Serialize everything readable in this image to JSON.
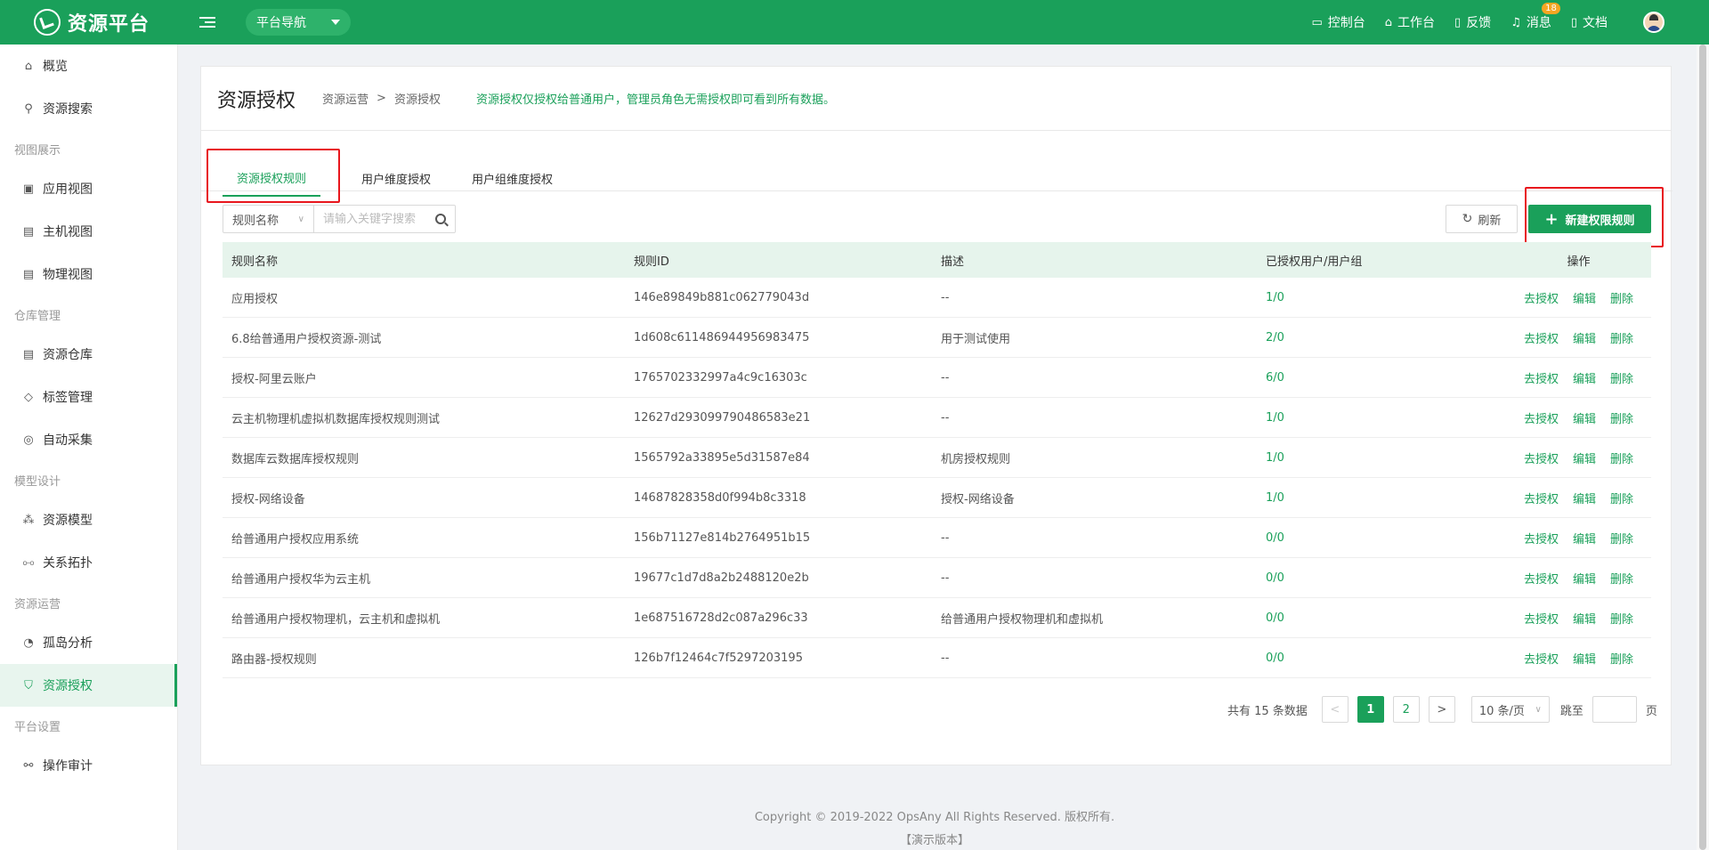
{
  "topbar": {
    "app_name": "资源平台",
    "nav_select": "平台导航",
    "items": [
      {
        "label": "控制台",
        "icon": "monitor-icon"
      },
      {
        "label": "工作台",
        "icon": "home-icon"
      },
      {
        "label": "反馈",
        "icon": "document-icon"
      },
      {
        "label": "消息",
        "icon": "bell-icon",
        "badge": "18"
      },
      {
        "label": "文档",
        "icon": "document-icon"
      }
    ]
  },
  "sidebar": {
    "overview": "概览",
    "search": "资源搜索",
    "group_view": "视图展示",
    "app_view": "应用视图",
    "host_view": "主机视图",
    "physical_view": "物理视图",
    "group_warehouse": "仓库管理",
    "resource_warehouse": "资源仓库",
    "tag_mgmt": "标签管理",
    "auto_collect": "自动采集",
    "group_model": "模型设计",
    "resource_model": "资源模型",
    "topology": "关系拓扑",
    "group_ops": "资源运营",
    "island": "孤岛分析",
    "auth": "资源授权",
    "group_platform": "平台设置",
    "audit": "操作审计"
  },
  "page": {
    "title": "资源授权",
    "breadcrumb": [
      "资源运营",
      ">",
      "资源授权"
    ],
    "notice": "资源授权仅授权给普通用户，管理员角色无需授权即可看到所有数据。"
  },
  "tabs": [
    "资源授权规则",
    "用户维度授权",
    "用户组维度授权"
  ],
  "filter": {
    "select": "规则名称",
    "placeholder": "请输入关键字搜索"
  },
  "buttons": {
    "refresh": "刷新",
    "new": "新建权限规则"
  },
  "table": {
    "headers": [
      "规则名称",
      "规则ID",
      "描述",
      "已授权用户/用户组",
      "操作"
    ],
    "actions": [
      "去授权",
      "编辑",
      "删除"
    ],
    "rows": [
      [
        "应用授权",
        "146e89849b881c062779043d",
        "--",
        "1/0"
      ],
      [
        "6.8给普通用户授权资源-测试",
        "1d608c611486944956983475",
        "用于测试使用",
        "2/0"
      ],
      [
        "授权-阿里云账户",
        "1765702332997a4c9c16303c",
        "--",
        "6/0"
      ],
      [
        "云主机物理机虚拟机数据库授权规则测试",
        "12627d293099790486583e21",
        "--",
        "1/0"
      ],
      [
        "数据库云数据库授权规则",
        "1565792a33895e5d31587e84",
        "机房授权规则",
        "1/0"
      ],
      [
        "授权-网络设备",
        "14687828358d0f994b8c3318",
        "授权-网络设备",
        "1/0"
      ],
      [
        "给普通用户授权应用系统",
        "156b71127e814b2764951b15",
        "--",
        "0/0"
      ],
      [
        "给普通用户授权华为云主机",
        "19677c1d7d8a2b2488120e2b",
        "--",
        "0/0"
      ],
      [
        "给普通用户授权物理机，云主机和虚拟机",
        "1e687516728d2c087a296c33",
        "给普通用户授权物理机和虚拟机",
        "0/0"
      ],
      [
        "路由器-授权规则",
        "126b7f12464c7f5297203195",
        "--",
        "0/0"
      ]
    ]
  },
  "pagination": {
    "total": "共有 15 条数据",
    "prev": "<",
    "pages": [
      "1",
      "2"
    ],
    "next": ">",
    "page_size": "10 条/页",
    "jump": "跳至",
    "page_unit": "页"
  },
  "footer": {
    "copyright": "Copyright © 2019-2022 OpsAny All Rights Reserved. 版权所有.",
    "version": "【演示版本】"
  },
  "colors": {
    "primary": "#1aa05a",
    "highlight": "#e8161d"
  }
}
